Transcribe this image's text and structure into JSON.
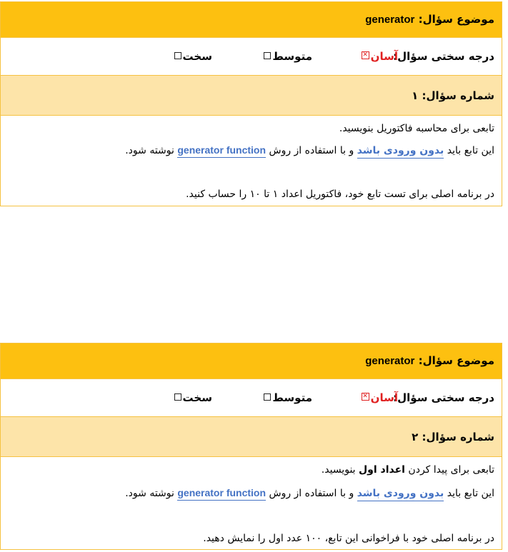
{
  "questions": [
    {
      "topic_label": "موضوع سؤال:",
      "topic_value": "generator",
      "difficulty_label": "درجه سختی سؤال:",
      "difficulty_options": [
        "آسان",
        "متوسط",
        "سخت"
      ],
      "selected_mark": "☒",
      "number_label": "شماره سؤال: ۱",
      "lines": {
        "l1": "تابعی برای محاسبه فاکتوریل بنویسید.",
        "l2_a": "این تابع باید ",
        "l2_b": "بدون ورودی باشد",
        "l2_c": " و با استفاده از روش ",
        "l2_d": "generator function",
        "l2_e": " نوشته شود.",
        "l3": "در برنامه اصلی برای تست تابع خود، فاکتوریل اعداد ۱ تا ۱۰ را حساب کنید."
      }
    },
    {
      "topic_label": "موضوع سؤال:",
      "topic_value": "generator",
      "difficulty_label": "درجه سختی سؤال:",
      "difficulty_options": [
        "آسان",
        "متوسط",
        "سخت"
      ],
      "selected_mark": "☒",
      "number_label": "شماره سؤال: ۲",
      "lines": {
        "l1_a": "تابعی برای پیدا کردن ",
        "l1_b": "اعداد اول",
        "l1_c": " بنویسید.",
        "l2_a": "این تابع باید ",
        "l2_b": "بدون ورودی باشد",
        "l2_c": " و با استفاده از روش ",
        "l2_d": "generator function",
        "l2_e": " نوشته شود.",
        "l3": "در برنامه اصلی خود با فراخوانی این تابع، ۱۰۰ عدد اول را نمایش دهید."
      }
    }
  ]
}
